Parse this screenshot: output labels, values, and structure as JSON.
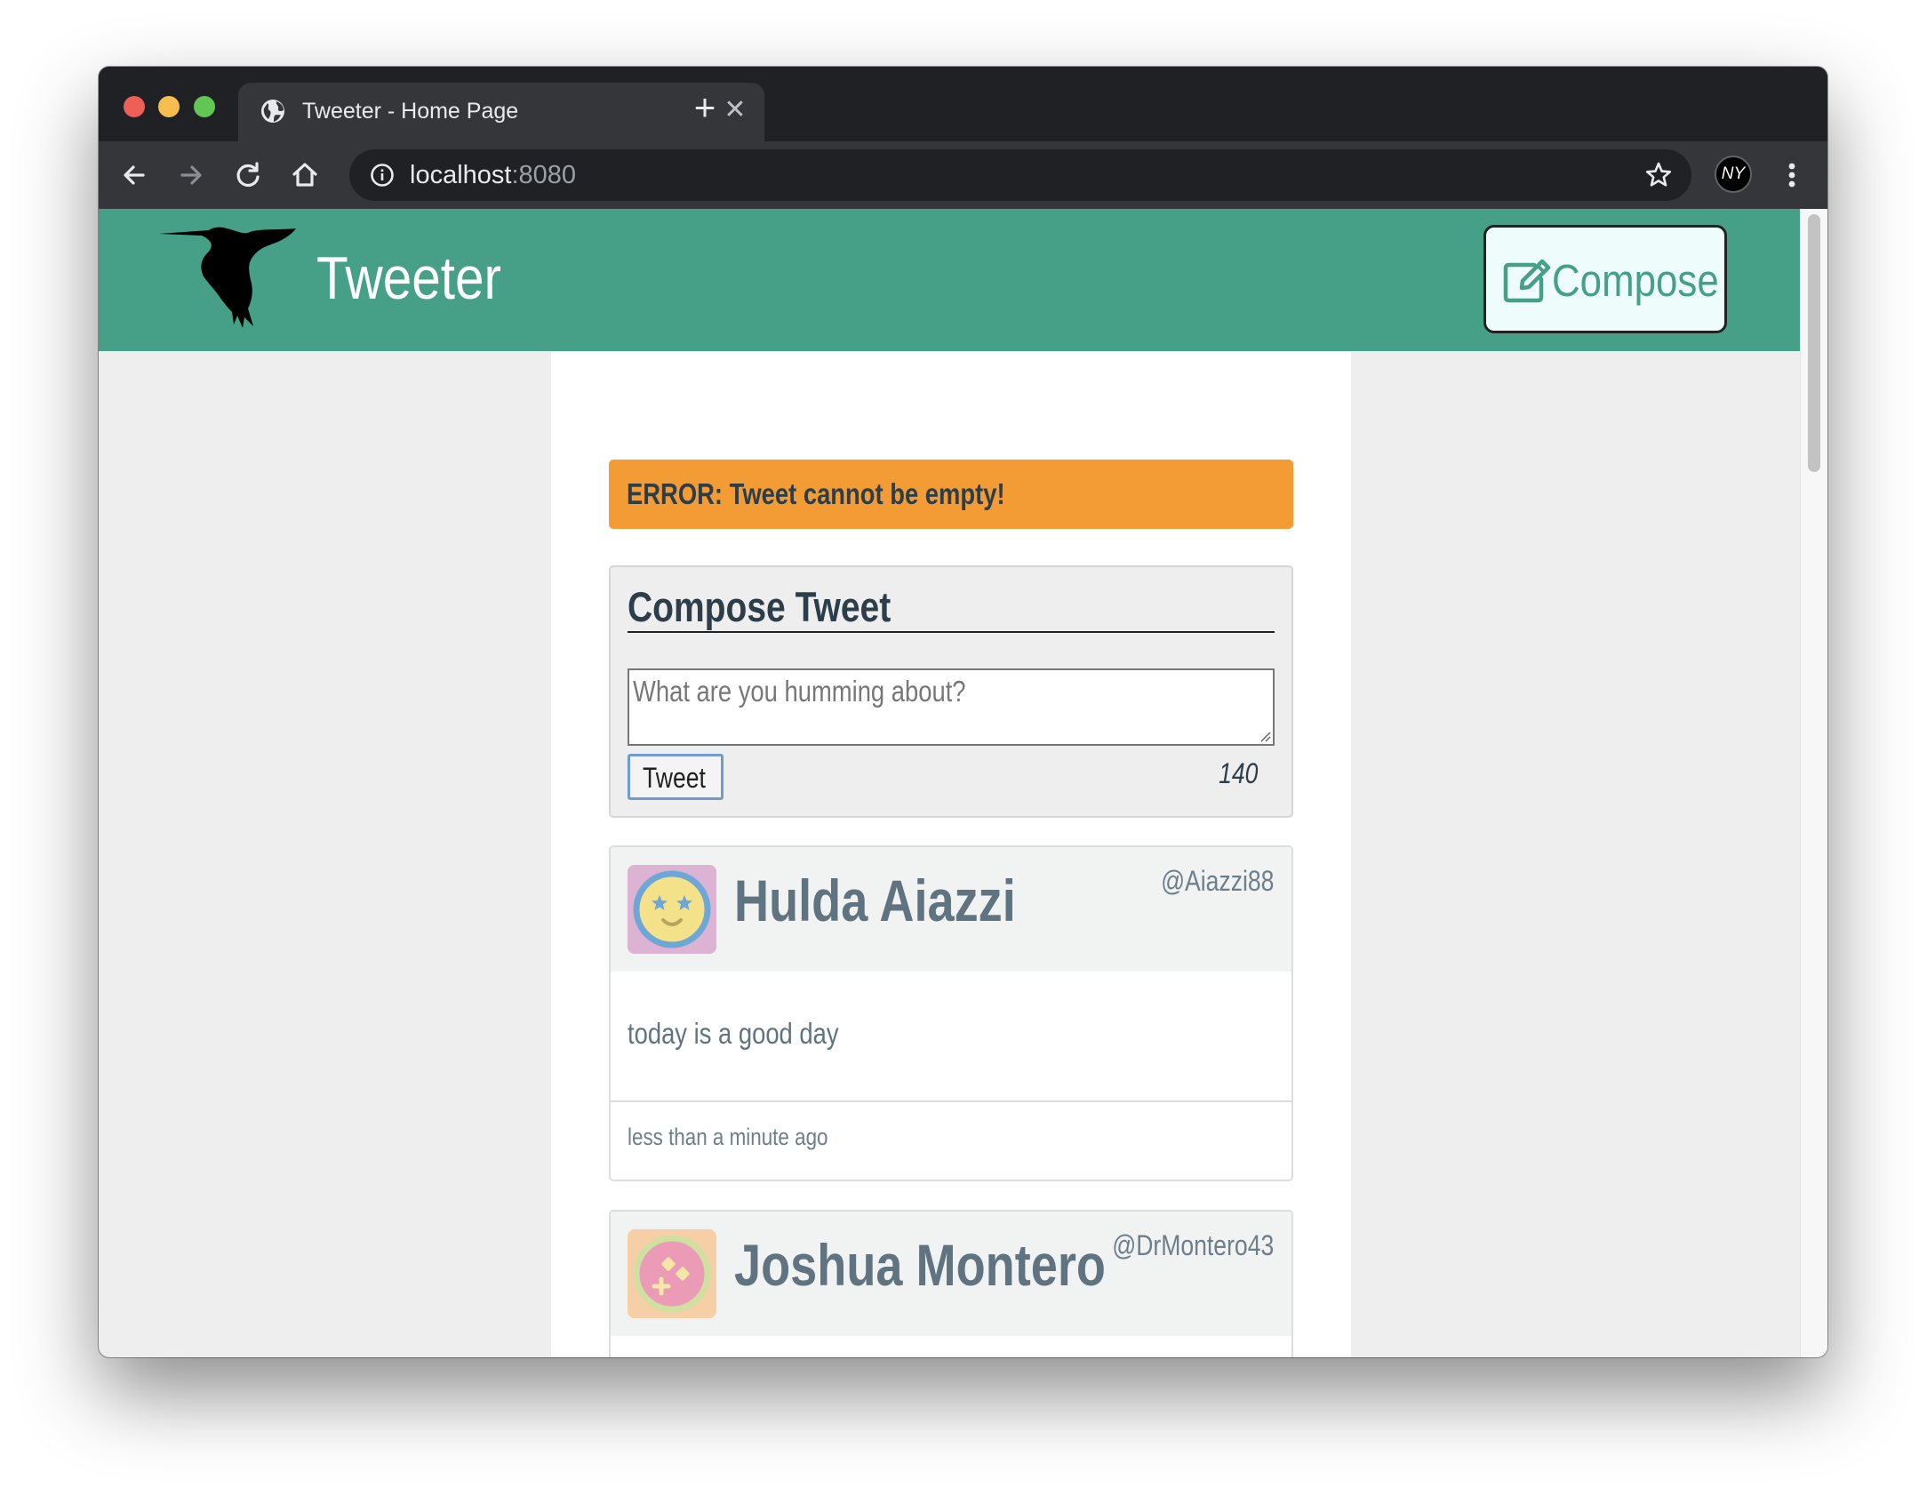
{
  "browser": {
    "tab_title": "Tweeter - Home Page",
    "tab_close": "✕",
    "new_tab": "+",
    "url_host": "localhost",
    "url_port": ":8080",
    "profile_initials": "NY"
  },
  "app": {
    "title": "Tweeter",
    "compose_label": "Compose",
    "accent_color": "#469f87"
  },
  "error": {
    "message": "ERROR: Tweet cannot be empty!",
    "color": "#f39c36"
  },
  "composer": {
    "heading": "Compose Tweet",
    "placeholder": "What are you humming about?",
    "button_label": "Tweet",
    "counter": "140"
  },
  "tweets": [
    {
      "name": "Hulda Aiazzi",
      "handle": "@Aiazzi88",
      "text": "today is a good day",
      "time": "less than a minute ago",
      "avatar_icon": "star-eyes-face-icon"
    },
    {
      "name": "Joshua Montero",
      "handle": "@DrMontero43",
      "avatar_icon": "pink-dots-face-icon"
    }
  ]
}
